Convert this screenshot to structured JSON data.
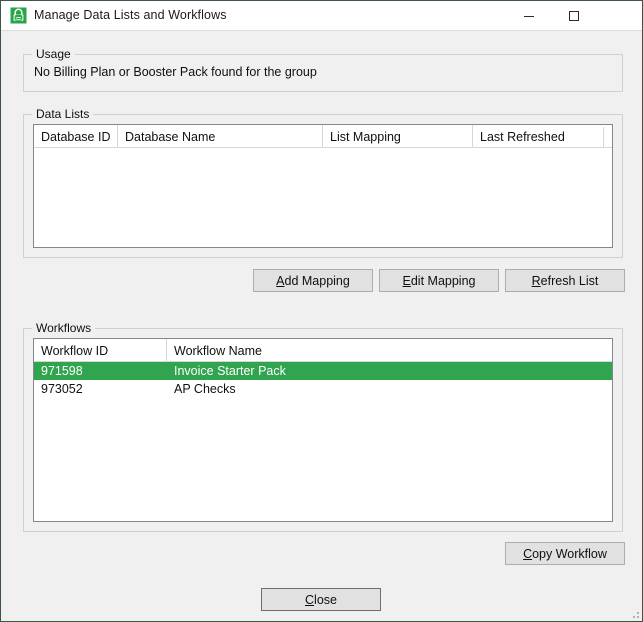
{
  "window": {
    "title": "Manage Data Lists and Workflows",
    "icon": "database-lock-icon",
    "controls": {
      "minimize": "minimize-icon",
      "maximize": "maximize-icon",
      "close": "close-icon"
    },
    "accent_green": "#30a44e",
    "border_color": "#3f5544"
  },
  "usage": {
    "legend": "Usage",
    "message": "No Billing Plan or Booster Pack found for the group"
  },
  "data_lists": {
    "legend": "Data Lists",
    "columns": [
      {
        "label": "Database ID"
      },
      {
        "label": "Database Name"
      },
      {
        "label": "List Mapping"
      },
      {
        "label": "Last Refreshed"
      }
    ],
    "rows": [],
    "buttons": {
      "add_mapping": {
        "pre": "",
        "mnemonic": "A",
        "post": "dd Mapping"
      },
      "edit_mapping": {
        "pre": "",
        "mnemonic": "E",
        "post": "dit Mapping"
      },
      "refresh_list": {
        "pre": "",
        "mnemonic": "R",
        "post": "efresh List"
      }
    }
  },
  "workflows": {
    "legend": "Workflows",
    "columns": [
      {
        "label": "Workflow ID"
      },
      {
        "label": "Workflow Name"
      }
    ],
    "rows": [
      {
        "id": "971598",
        "name": "Invoice Starter Pack",
        "selected": true
      },
      {
        "id": "973052",
        "name": "AP Checks",
        "selected": false
      }
    ],
    "buttons": {
      "copy_workflow": {
        "pre": "",
        "mnemonic": "C",
        "post": "opy Workflow"
      }
    }
  },
  "dialog": {
    "close_button": {
      "pre": "",
      "mnemonic": "C",
      "post": "lose"
    }
  }
}
